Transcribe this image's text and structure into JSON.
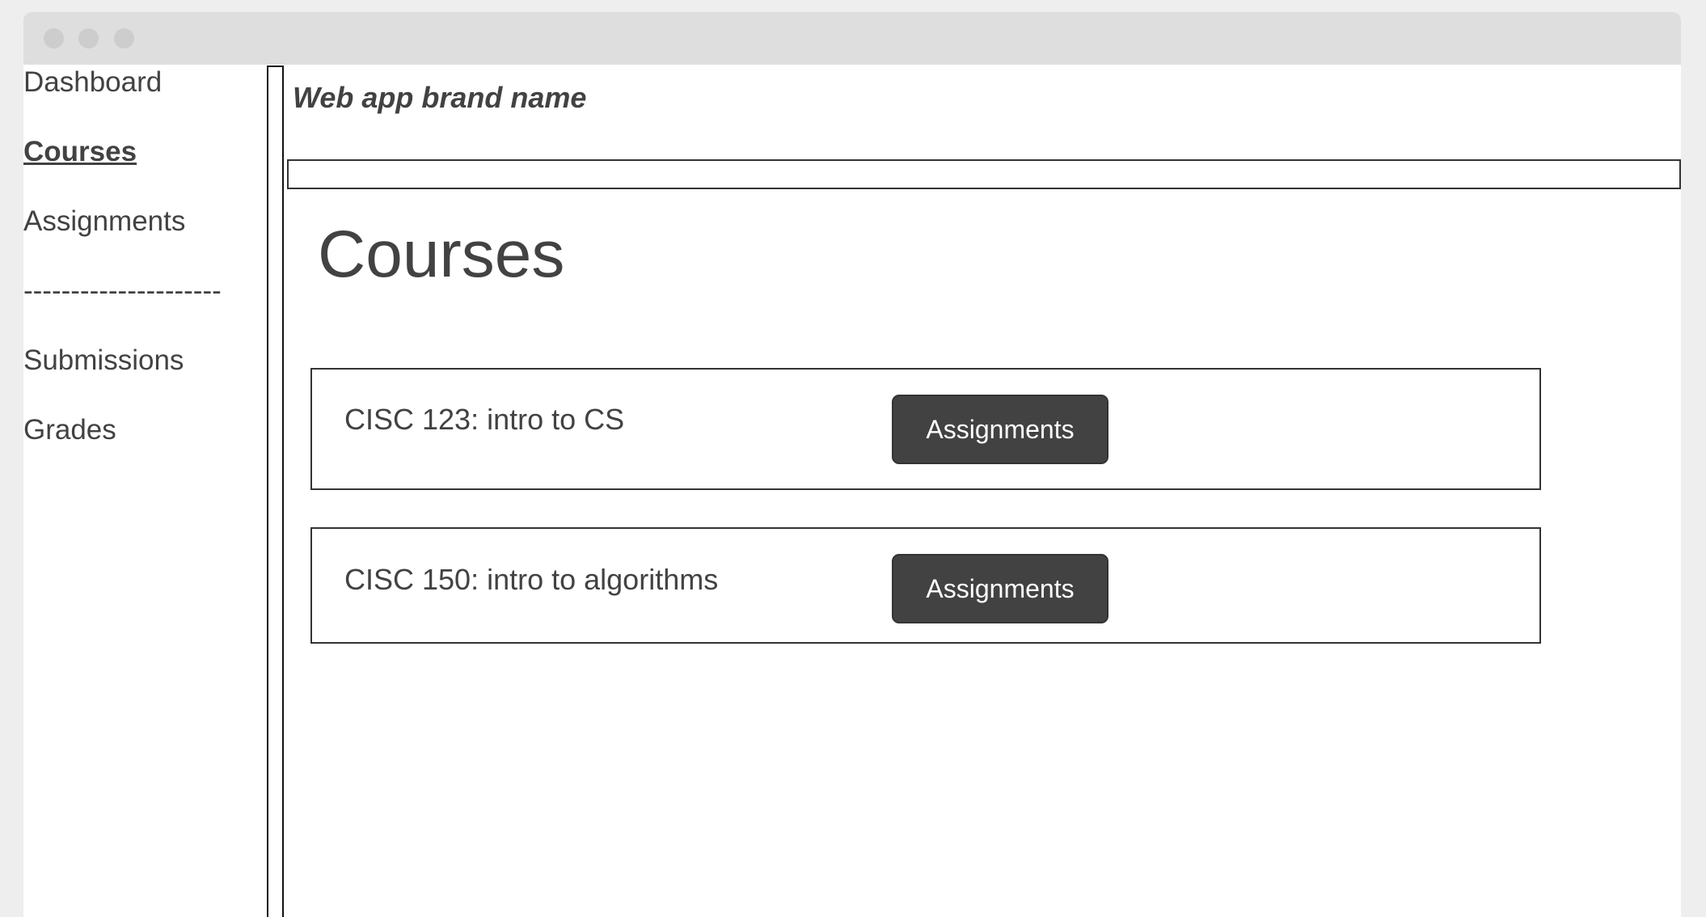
{
  "window": {
    "controls": [
      "close-dot",
      "minimize-dot",
      "maximize-dot"
    ]
  },
  "sidebar": {
    "items": [
      {
        "label": "Dashboard",
        "active": false
      },
      {
        "label": "Courses",
        "active": true
      },
      {
        "label": "Assignments",
        "active": false
      },
      {
        "label": "---------------------",
        "divider": true
      },
      {
        "label": "Submissions",
        "active": false
      },
      {
        "label": "Grades",
        "active": false
      }
    ]
  },
  "header": {
    "brand": "Web app brand name"
  },
  "main": {
    "title": "Courses",
    "courses": [
      {
        "name": "CISC 123: intro to CS",
        "button_label": "Assignments"
      },
      {
        "name": "CISC 150: intro to algorithms",
        "button_label": "Assignments"
      }
    ]
  },
  "colors": {
    "page_background": "#eeeeee",
    "titlebar": "#dedede",
    "window_dot": "#cdcdcd",
    "text": "#424242",
    "button_background": "#424242",
    "button_text": "#ffffff"
  }
}
